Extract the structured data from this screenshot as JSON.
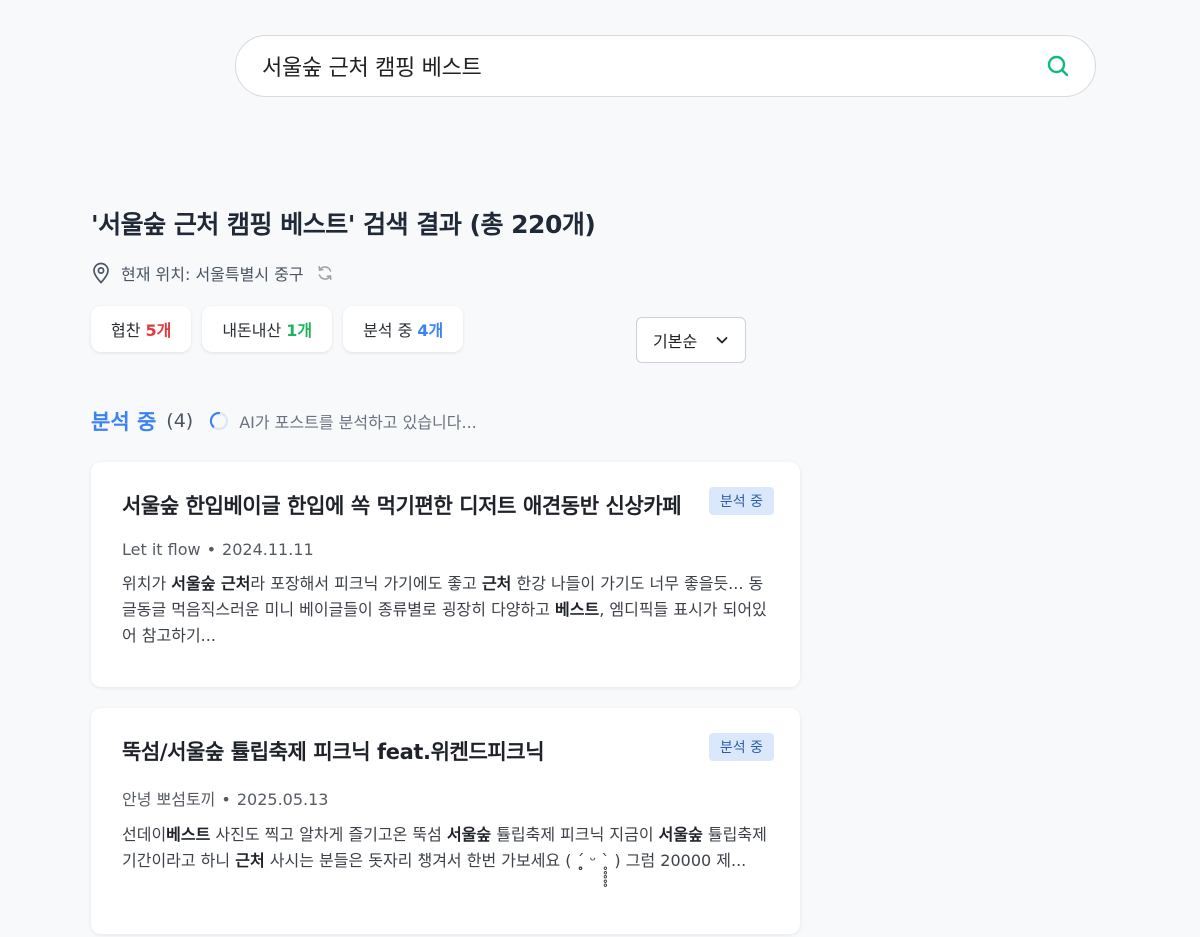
{
  "search": {
    "query": "서울숲 근처 캠핑 베스트"
  },
  "results": {
    "title": "'서울숲 근처 캠핑 베스트' 검색 결과 (총 220개)",
    "location": "현재 위치: 서울특별시 중구"
  },
  "filters": [
    {
      "label": "협찬",
      "count": "5개",
      "color": "#e5383b"
    },
    {
      "label": "내돈내산",
      "count": "1개",
      "color": "#22b15c"
    },
    {
      "label": "분석 중",
      "count": "4개",
      "color": "#3b82f6"
    }
  ],
  "sort": {
    "selected": "기본순"
  },
  "section": {
    "title": "분석 중",
    "count": "(4)",
    "status": "AI가 포스트를 분석하고 있습니다..."
  },
  "posts": [
    {
      "title": "서울숲 한입베이글 한입에 쏙 먹기편한 디저트 애견동반 신상카페",
      "badge": "분석 중",
      "author": "Let it flow",
      "date": "2024.11.11",
      "snippet_parts": [
        [
          "위치가 ",
          false
        ],
        [
          "서울숲 근처",
          true
        ],
        [
          "라 포장해서 피크닉 가기에도 좋고 ",
          false
        ],
        [
          "근처",
          true
        ],
        [
          " 한강 나들이 가기도 너무 좋을듯... 동글동글 먹음직스러운 미니 베이글들이 종류별로 굉장히 다양하고 ",
          false
        ],
        [
          "베스트",
          true
        ],
        [
          ", 엠디픽들 표시가 되어있어 참고하기...",
          false
        ]
      ]
    },
    {
      "title": "뚝섬/서울숲 튤립축제 피크닉 feat.위켄드피크닉",
      "badge": "분석 중",
      "author": "안녕 뽀섬토끼",
      "date": "2025.05.13",
      "snippet_parts": [
        [
          "선데이",
          false
        ],
        [
          "베스트",
          true
        ],
        [
          " 사진도 찍고 알차게 즐기고온 뚝섬 ",
          false
        ],
        [
          "서울숲",
          true
        ],
        [
          " 튤립축제 피크닉 지금이 ",
          false
        ],
        [
          "서울숲",
          true
        ],
        [
          " 튤립축제 기간이라고 하니 ",
          false
        ],
        [
          "근처",
          true
        ],
        [
          " 사시는 분들은 돗자리 챙겨서 한번 가보세요 ( ˊ̥̥̥̥̥ ᵕ ˋ̥̥̥̥̥ ) 그럼 20000 제...",
          false
        ]
      ]
    }
  ],
  "colors": {
    "accent": "#3b82f6",
    "search_icon": "#10b981",
    "badge_bg": "#dbe8fb"
  }
}
